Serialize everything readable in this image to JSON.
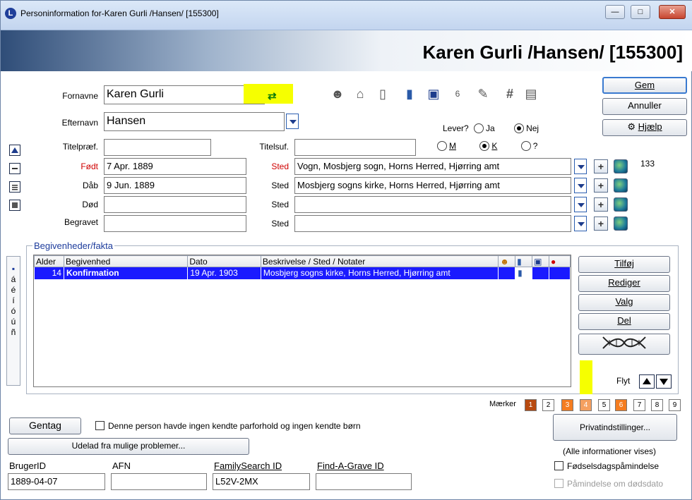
{
  "window": {
    "title": "Personinformation for-Karen Gurli /Hansen/ [155300]",
    "app_icon": "L",
    "minimize": "—",
    "maximize": "□",
    "close": "✕"
  },
  "banner_title": "Karen Gurli /Hansen/ [155300]",
  "labels": {
    "fornavne": "Fornavne",
    "efternavn": "Efternavn",
    "titelpraef": "Titelpræf.",
    "titelsuf": "Titelsuf.",
    "foedt": "Født",
    "daab": "Dåb",
    "doed": "Død",
    "begravet": "Begravet",
    "sted": "Sted",
    "lever": "Lever?",
    "ja": "Ja",
    "nej": "Nej",
    "m": "M",
    "k": "K",
    "q": "?"
  },
  "fields": {
    "fornavne": "Karen Gurli",
    "efternavn": "Hansen",
    "titelpraef": "",
    "titelsuf": "",
    "foedt_dato": "7 Apr. 1889",
    "foedt_sted": "Vogn, Mosbjerg sogn, Horns Herred, Hjørring amt",
    "daab_dato": "9 Jun. 1889",
    "daab_sted": "Mosbjerg sogns kirke, Horns Herred, Hjørring amt",
    "doed_dato": "",
    "doed_sted": "",
    "begravet_dato": "",
    "begravet_sted": ""
  },
  "place_count": "133",
  "buttons": {
    "gem": "Gem",
    "annuller": "Annuller",
    "hjaelp": "Hjælp",
    "tilfoej": "Tilføj",
    "rediger": "Rediger",
    "valg": "Valg",
    "del": "Del",
    "dna": "DNA",
    "gentag": "Gentag",
    "udelad": "Udelad fra mulige problemer...",
    "privat": "Privatindstillinger..."
  },
  "events": {
    "legend": "Begivenheder/fakta",
    "columns": [
      "Alder",
      "Begivenhed",
      "Dato",
      "Beskrivelse / Sted / Notater"
    ],
    "rows": [
      {
        "alder": "14",
        "begivenhed": "Konfirmation",
        "dato": "19 Apr. 1903",
        "beskrivelse": "Mosbjerg sogns kirke, Horns Herred, Hjørring amt"
      }
    ]
  },
  "flyt": "Flyt",
  "maerker": {
    "label": "Mærker",
    "items": [
      "1",
      "2",
      "3",
      "4",
      "5",
      "6",
      "7",
      "8",
      "9"
    ]
  },
  "side_chars": [
    "á",
    "é",
    "í",
    "ó",
    "ú",
    "ñ"
  ],
  "no_partner_text": "Denne person havde ingen kendte parforhold og ingen kendte børn",
  "all_info_text": "(Alle informationer vises)",
  "birthday_reminder": "Fødselsdagspåmindelse",
  "death_reminder": "Påmindelse om dødsdato",
  "ids": {
    "bruger_label": "BrugerID",
    "bruger": "1889-04-07",
    "afn_label": "AFN",
    "afn": "",
    "fs_label": "FamilySearch ID",
    "fs": "L52V-2MX",
    "fag_label": "Find-A-Grave ID",
    "fag": ""
  }
}
